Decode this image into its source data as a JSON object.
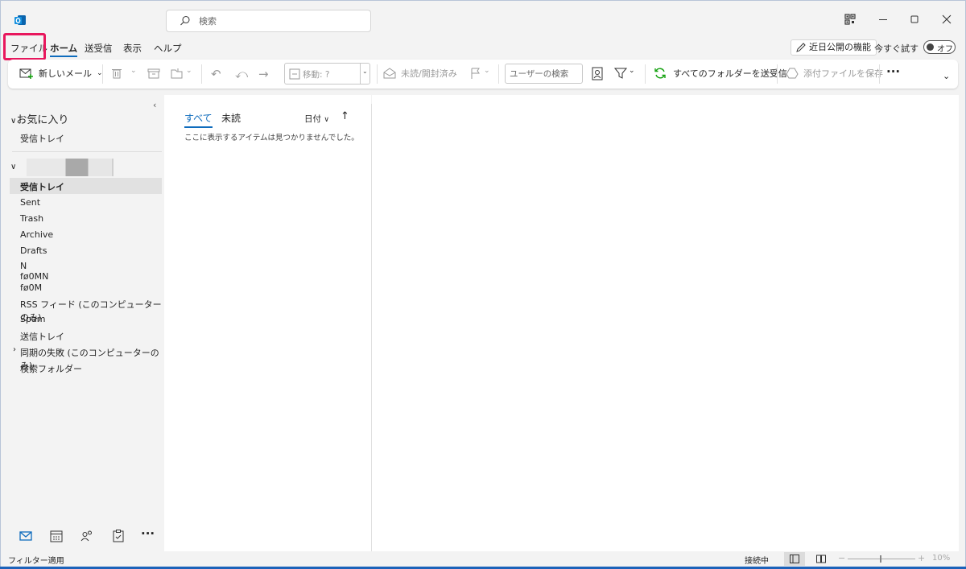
{
  "titlebar": {
    "search_placeholder": "検索",
    "icons": [
      "outlook-logo",
      "search-icon",
      "qr-icon",
      "minimize-icon",
      "maximize-icon",
      "close-icon"
    ]
  },
  "menu": {
    "tabs": [
      "ファイル",
      "ホーム",
      "送受信",
      "表示",
      "ヘルプ"
    ],
    "active": "ホーム",
    "upcoming_features": "近日公開の機能",
    "try_now": "今すぐ試す",
    "toggle_label": "オフ"
  },
  "ribbon": {
    "new_mail": "新しいメール",
    "move_label": "移動: ?",
    "unread_read": "未読/開封済み",
    "user_search_placeholder": "ユーザーの検索",
    "send_receive_all": "すべてのフォルダーを送受信",
    "save_attachments": "添付ファイルを保存",
    "more": "···"
  },
  "folders": {
    "favorites_header": "お気に入り",
    "favorites": [
      "受信トレイ"
    ],
    "account_items": [
      "受信トレイ",
      "Sent",
      "Trash",
      "Archive",
      "Drafts",
      "N",
      "fø0MN",
      "fø0M",
      "RSS フィード (このコンピューターのみ)",
      "Spam",
      "送信トレイ",
      "同期の失敗 (このコンピューターのみ)",
      "検索フォルダー"
    ],
    "selected": "受信トレイ"
  },
  "message_list": {
    "tab_all": "すべて",
    "tab_unread": "未読",
    "sort_label": "日付",
    "sort_arrow": "↑",
    "empty_text": "ここに表示するアイテムは見つかりませんでした。"
  },
  "status": {
    "filter": "フィルター適用",
    "connection": "接続中",
    "zoom": "10%"
  },
  "colors": {
    "accent": "#0f6cbd",
    "highlight_box": "#e8175d"
  }
}
